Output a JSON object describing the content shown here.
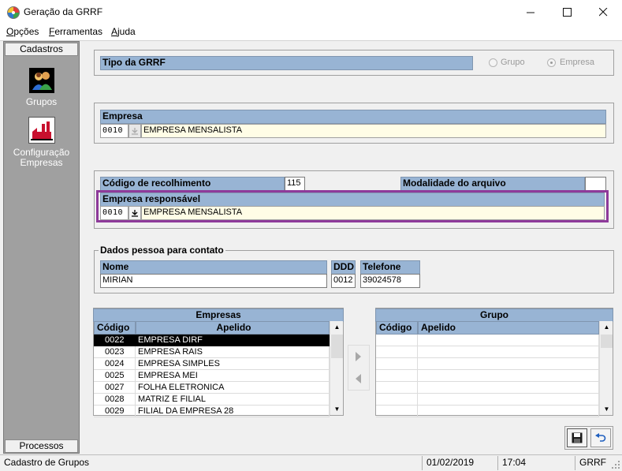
{
  "window": {
    "title": "Geração da GRRF",
    "minimize": "—",
    "maximize": "☐",
    "close": "✕"
  },
  "menu": {
    "opcoes": {
      "accel": "O",
      "rest": "pções"
    },
    "ferramentas": {
      "accel": "F",
      "rest": "erramentas"
    },
    "ajuda": {
      "accel": "A",
      "rest": "juda"
    }
  },
  "sidebar": {
    "header": "Cadastros",
    "items": [
      {
        "label": "Grupos",
        "icon": "users-group-icon"
      },
      {
        "label_line1": "Configuração",
        "label_line2": "Empresas",
        "icon": "factory-icon"
      }
    ],
    "footer": "Processos"
  },
  "tipo_grrf": {
    "label": "Tipo da GRRF",
    "options": [
      "Grupo",
      "Empresa"
    ],
    "selected": "Empresa"
  },
  "empresa": {
    "label": "Empresa",
    "code": "0010",
    "name": "EMPRESA MENSALISTA"
  },
  "recolhimento": {
    "codigo_label": "Código de recolhimento",
    "codigo_value": "115",
    "modalidade_label": "Modalidade do arquivo",
    "modalidade_value": ""
  },
  "empresa_responsavel": {
    "label": "Empresa responsável",
    "code": "0010",
    "name": "EMPRESA MENSALISTA"
  },
  "contato": {
    "group_label": "Dados pessoa para contato",
    "nome_label": "Nome",
    "nome_value": "MIRIAN",
    "ddd_label": "DDD",
    "ddd_value": "0012",
    "telefone_label": "Telefone",
    "telefone_value": "39024578"
  },
  "empresas_grid": {
    "title": "Empresas",
    "columns": [
      "Código",
      "Apelido"
    ],
    "rows": [
      {
        "codigo": "0022",
        "apelido": "EMPRESA DIRF"
      },
      {
        "codigo": "0023",
        "apelido": "EMPRESA RAIS"
      },
      {
        "codigo": "0024",
        "apelido": "EMPRESA SIMPLES"
      },
      {
        "codigo": "0025",
        "apelido": "EMPRESA MEI"
      },
      {
        "codigo": "0027",
        "apelido": "FOLHA ELETRONICA"
      },
      {
        "codigo": "0028",
        "apelido": "MATRIZ E FILIAL"
      },
      {
        "codigo": "0029",
        "apelido": "FILIAL DA EMPRESA 28"
      }
    ],
    "selected_index": 0
  },
  "grupo_grid": {
    "title": "Grupo",
    "columns": [
      "Código",
      "Apelido"
    ]
  },
  "actions": {
    "save_icon": "floppy-disk-icon",
    "undo_icon": "undo-arrow-icon"
  },
  "status": {
    "message": "Cadastro de Grupos",
    "date": "01/02/2019",
    "time": "17:04",
    "module": "GRRF"
  },
  "colors": {
    "header_blue": "#98b4d4",
    "highlight_border": "#8e3a9a",
    "field_yellow": "#fffde6",
    "sidebar_gray": "#a0a0a0"
  }
}
